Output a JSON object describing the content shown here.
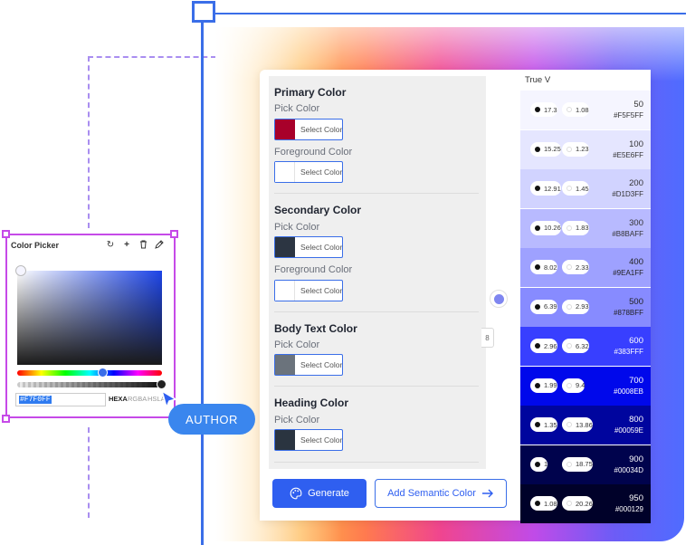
{
  "card": {
    "primary": {
      "title": "Primary Color",
      "pick_label": "Pick Color",
      "pick_btn": "Select Color",
      "pick_color": "#A8002A",
      "fg_label": "Foreground Color",
      "fg_btn": "Select Color",
      "fg_color": "#FFFFFF"
    },
    "secondary": {
      "title": "Secondary Color",
      "pick_label": "Pick Color",
      "pick_btn": "Select Color",
      "pick_color": "#2C3542",
      "fg_label": "Foreground Color",
      "fg_btn": "Select Color",
      "fg_color": "#FFFFFF"
    },
    "body_text": {
      "title": "Body Text Color",
      "pick_label": "Pick Color",
      "pick_btn": "Select Color",
      "pick_color": "#6B737C"
    },
    "heading": {
      "title": "Heading Color",
      "pick_label": "Pick Color",
      "pick_btn": "Select Color",
      "pick_color": "#2A3440"
    },
    "generate_label": "Generate",
    "add_semantic_label": "Add Semantic Color"
  },
  "palette": {
    "header": "True V",
    "shades": [
      {
        "num": "50",
        "hex": "#F5F5FF",
        "c1": "17.3",
        "c2": "1.08",
        "bg": "#F5F5FF",
        "text": "#333333"
      },
      {
        "num": "100",
        "hex": "#E5E6FF",
        "c1": "15.25",
        "c2": "1.23",
        "bg": "#E5E6FF",
        "text": "#333333"
      },
      {
        "num": "200",
        "hex": "#D1D3FF",
        "c1": "12.91",
        "c2": "1.45",
        "bg": "#D1D3FF",
        "text": "#333333"
      },
      {
        "num": "300",
        "hex": "#B8BAFF",
        "c1": "10.26",
        "c2": "1.83",
        "bg": "#B8BAFF",
        "text": "#333333"
      },
      {
        "num": "400",
        "hex": "#9EA1FF",
        "c1": "8.02",
        "c2": "2.33",
        "bg": "#9EA1FF",
        "text": "#222222"
      },
      {
        "num": "500",
        "hex": "#878BFF",
        "c1": "6.39",
        "c2": "2.93",
        "bg": "#878BFF",
        "text": "#222222"
      },
      {
        "num": "600",
        "hex": "#383FFF",
        "c1": "2.96",
        "c2": "6.32",
        "bg": "#383FFF",
        "text": "#FFFFFF"
      },
      {
        "num": "700",
        "hex": "#0008EB",
        "c1": "1.99",
        "c2": "9.4",
        "bg": "#0008EB",
        "text": "#FFFFFF"
      },
      {
        "num": "800",
        "hex": "#00059E",
        "c1": "1.35",
        "c2": "13.86",
        "bg": "#00059E",
        "text": "#FFFFFF"
      },
      {
        "num": "900",
        "hex": "#00034D",
        "c1": "1",
        "c2": "18.75",
        "bg": "#00034D",
        "text": "#FFFFFF"
      },
      {
        "num": "950",
        "hex": "#000129",
        "c1": "1.08",
        "c2": "20.26",
        "bg": "#000129",
        "text": "#FFFFFF"
      }
    ]
  },
  "picker": {
    "title": "Color Picker",
    "hex_value": "#F7F0FF",
    "modes": [
      "HEXA",
      "RGBA",
      "HSLA"
    ],
    "active_mode": "HEXA",
    "hue_position": 0.59,
    "alpha_position": 1.0
  },
  "author_label": "AUTHOR"
}
